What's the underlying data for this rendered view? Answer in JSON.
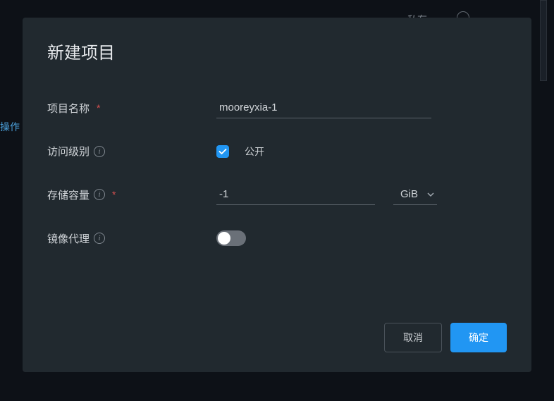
{
  "backdrop": {
    "left_text": "操作",
    "top_text": "私有"
  },
  "modal": {
    "title": "新建项目",
    "fields": {
      "project_name": {
        "label": "项目名称",
        "value": "mooreyxia-1"
      },
      "access_level": {
        "label": "访问级别",
        "option_label": "公开",
        "checked": true
      },
      "storage": {
        "label": "存储容量",
        "value": "-1",
        "unit": "GiB"
      },
      "proxy": {
        "label": "镜像代理",
        "enabled": false
      }
    },
    "buttons": {
      "cancel": "取消",
      "confirm": "确定"
    }
  }
}
